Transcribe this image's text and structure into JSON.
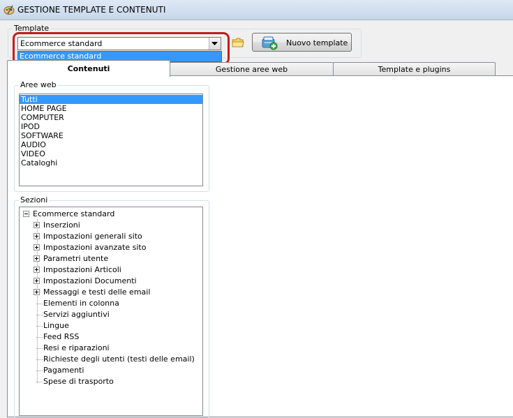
{
  "window": {
    "title": "GESTIONE TEMPLATE E CONTENUTI"
  },
  "template_group": {
    "legend": "Template",
    "combo_value": "Ecommerce standard",
    "dropdown_options": [
      "Ecommerce standard"
    ],
    "new_template_label": "Nuovo template"
  },
  "tabs": [
    {
      "label": "Contenuti",
      "active": true
    },
    {
      "label": "Gestione aree web",
      "active": false
    },
    {
      "label": "Template e plugins",
      "active": false
    }
  ],
  "aree_web": {
    "legend": "Aree web",
    "items": [
      "Tutti",
      "HOME PAGE",
      "COMPUTER",
      "IPOD",
      "SOFTWARE",
      "AUDIO",
      "VIDEO",
      "Cataloghi"
    ],
    "selected": "Tutti"
  },
  "sezioni": {
    "legend": "Sezioni",
    "root": "Ecommerce standard",
    "children": [
      {
        "label": "Inserzioni",
        "expandable": true
      },
      {
        "label": "Impostazioni generali sito",
        "expandable": true
      },
      {
        "label": "Impostazioni avanzate sito",
        "expandable": true
      },
      {
        "label": "Parametri utente",
        "expandable": true
      },
      {
        "label": "Impostazioni Articoli",
        "expandable": true
      },
      {
        "label": "Impostazioni Documenti",
        "expandable": true
      },
      {
        "label": "Messaggi e testi delle email",
        "expandable": true
      },
      {
        "label": "Elementi in colonna",
        "expandable": false
      },
      {
        "label": "Servizi aggiuntivi",
        "expandable": false
      },
      {
        "label": "Lingue",
        "expandable": false
      },
      {
        "label": "Feed RSS",
        "expandable": false
      },
      {
        "label": "Resi e riparazioni",
        "expandable": false
      },
      {
        "label": "Richieste degli utenti (testi delle email)",
        "expandable": false
      },
      {
        "label": "Pagamenti",
        "expandable": false
      },
      {
        "label": "Spese di trasporto",
        "expandable": false
      }
    ]
  },
  "colors": {
    "selection": "#3399ff",
    "highlight_oval": "#c61b1b"
  },
  "icons": {
    "app": "paint-palette-icon",
    "folder": "folder-icon",
    "new_template": "add-template-icon",
    "combo_arrow": "chevron-down-icon"
  }
}
